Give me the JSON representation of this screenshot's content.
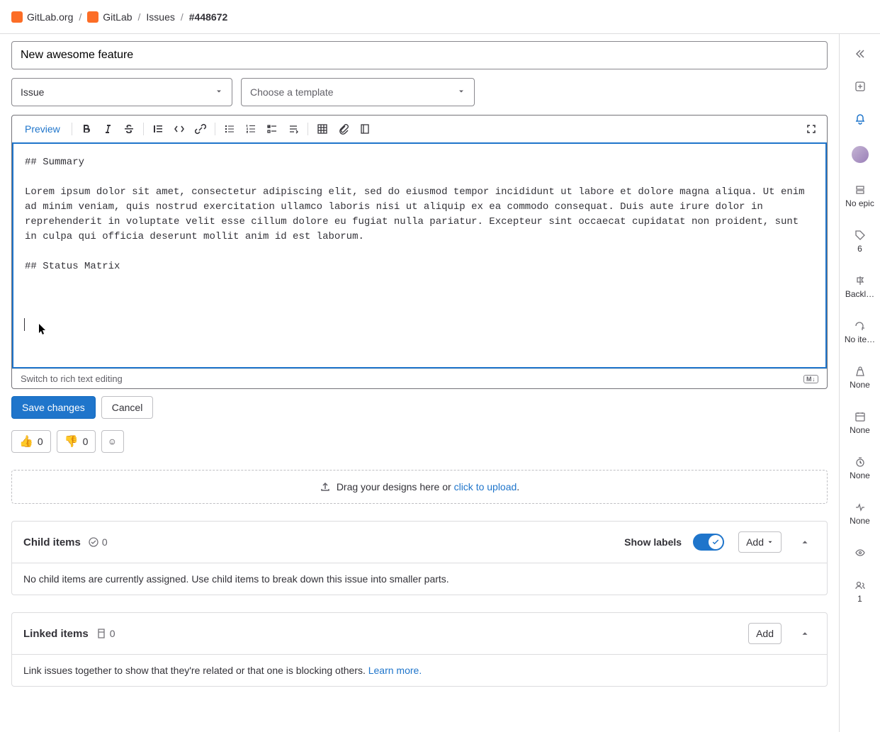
{
  "breadcrumbs": {
    "org": "GitLab.org",
    "project": "GitLab",
    "issues": "Issues",
    "id": "#448672"
  },
  "form": {
    "title_value": "New awesome feature",
    "type_value": "Issue",
    "template_placeholder": "Choose a template"
  },
  "editor": {
    "preview_label": "Preview",
    "content": "## Summary\n\nLorem ipsum dolor sit amet, consectetur adipiscing elit, sed do eiusmod tempor incididunt ut labore et dolore magna aliqua. Ut enim ad minim veniam, quis nostrud exercitation ullamco laboris nisi ut aliquip ex ea commodo consequat. Duis aute irure dolor in reprehenderit in voluptate velit esse cillum dolore eu fugiat nulla pariatur. Excepteur sint occaecat cupidatat non proident, sunt in culpa qui officia deserunt mollit anim id est laborum.\n\n## Status Matrix\n\n\n",
    "switch_text": "Switch to rich text editing",
    "md_badge": "M↓"
  },
  "actions": {
    "save": "Save changes",
    "cancel": "Cancel"
  },
  "reactions": {
    "thumbs_up": {
      "emoji": "👍",
      "count": "0"
    },
    "thumbs_down": {
      "emoji": "👎",
      "count": "0"
    }
  },
  "dropzone": {
    "text_before": "Drag your designs here or ",
    "link": "click to upload",
    "text_after": "."
  },
  "child_items": {
    "title": "Child items",
    "count": "0",
    "show_labels": "Show labels",
    "add": "Add",
    "body": "No child items are currently assigned. Use child items to break down this issue into smaller parts."
  },
  "linked_items": {
    "title": "Linked items",
    "count": "0",
    "add": "Add",
    "body_text": "Link issues together to show that they're related or that one is blocking others. ",
    "learn_more": "Learn more."
  },
  "sidebar": {
    "epic": "No epic",
    "requirements": "6",
    "milestone": "Backl…",
    "iteration": "No ite…",
    "weight": "None",
    "dates": "None",
    "time": "None",
    "health": "None",
    "participants": "1"
  }
}
